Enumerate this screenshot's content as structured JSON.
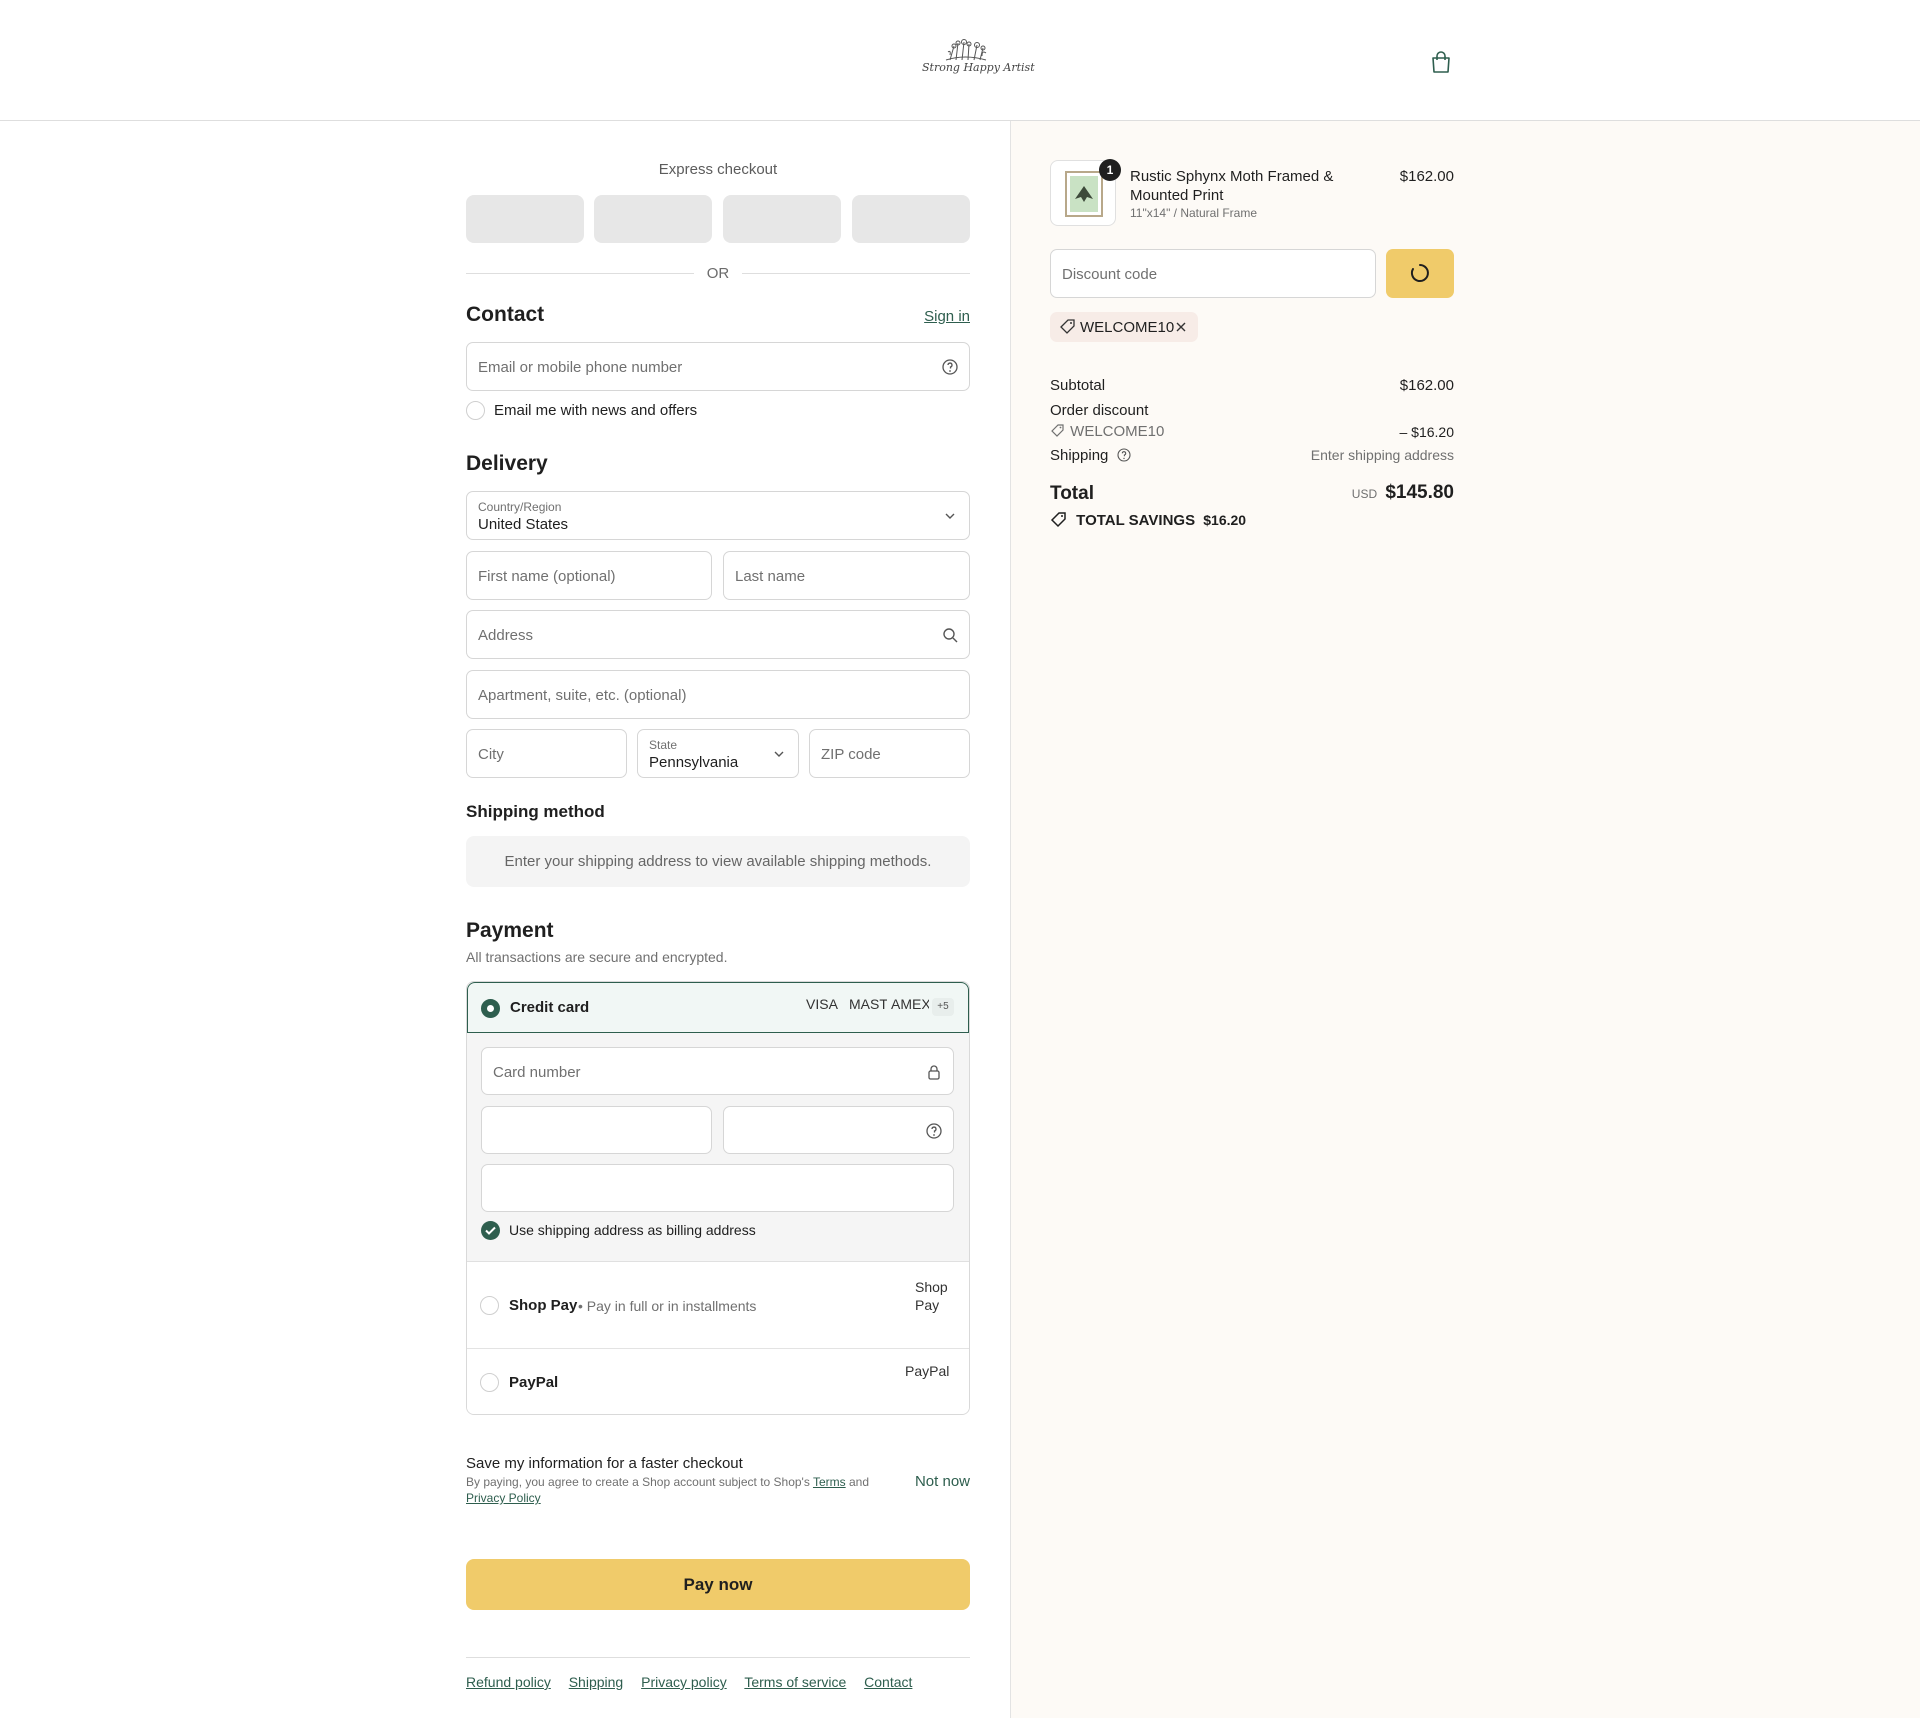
{
  "header": {
    "logo_text": "Strong Happy Artist",
    "cart_icon": "shopping-bag-icon"
  },
  "express": {
    "title": "Express checkout",
    "or_label": "OR"
  },
  "contact": {
    "title": "Contact",
    "sign_in": "Sign in",
    "email_placeholder": "Email or mobile phone number",
    "news_label": "Email me with news and offers"
  },
  "delivery": {
    "title": "Delivery",
    "country_label": "Country/Region",
    "country_value": "United States",
    "first_name_placeholder": "First name (optional)",
    "last_name_placeholder": "Last name",
    "address_placeholder": "Address",
    "apartment_placeholder": "Apartment, suite, etc. (optional)",
    "city_placeholder": "City",
    "state_label": "State",
    "state_value": "Pennsylvania",
    "zip_placeholder": "ZIP code"
  },
  "shipping_method": {
    "title": "Shipping method",
    "notice": "Enter your shipping address to view available shipping methods."
  },
  "payment": {
    "title": "Payment",
    "subtitle": "All transactions are secure and encrypted.",
    "credit_card_label": "Credit card",
    "card_logos": [
      "VISA",
      "MASTER",
      "AMEX"
    ],
    "more_cards": "+5",
    "card_number_placeholder": "Card number",
    "billing_same_label": "Use shipping address as billing address",
    "shop_pay_label": "Shop Pay",
    "shop_pay_sub": "• Pay in full or in installments",
    "shop_pay_logo_alt": "Shop Pay",
    "paypal_label": "PayPal",
    "paypal_logo_alt": "PayPal"
  },
  "save_info": {
    "title": "Save my information for a faster checkout",
    "text_prefix": "By paying, you agree to create a Shop account subject to Shop's ",
    "terms": "Terms",
    "and": " and",
    "privacy": "Privacy Policy",
    "not_now": "Not now"
  },
  "pay_now_label": "Pay now",
  "footer": {
    "links": [
      "Refund policy",
      "Shipping",
      "Privacy policy",
      "Terms of service",
      "Contact"
    ]
  },
  "summary": {
    "product": {
      "name": "Rustic Sphynx Moth Framed & Mounted Print",
      "variant": "11\"x14\" / Natural Frame",
      "price": "$162.00",
      "quantity": "1"
    },
    "discount_placeholder": "Discount code",
    "applied_code": "WELCOME10",
    "subtotal_label": "Subtotal",
    "subtotal_value": "$162.00",
    "order_discount_label": "Order discount",
    "discount_code": "WELCOME10",
    "discount_value": "– $16.20",
    "shipping_label": "Shipping",
    "shipping_value": "Enter shipping address",
    "total_label": "Total",
    "currency": "USD",
    "total_value": "$145.80",
    "savings_label": "TOTAL SAVINGS",
    "savings_value": "$16.20"
  },
  "colors": {
    "accent": "#2e5e4e",
    "button": "#f0cb6a",
    "summary_bg": "#fdfaf6"
  }
}
